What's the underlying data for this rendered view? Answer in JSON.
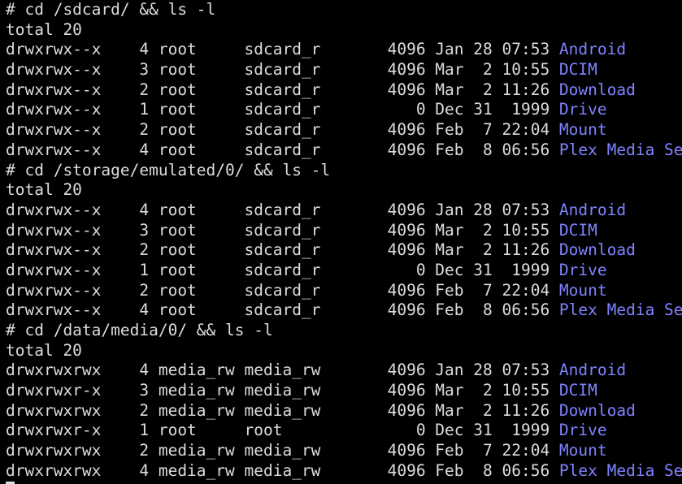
{
  "colors": {
    "background": "#000000",
    "text": "#dcdcdc",
    "directory": "#7f83ff"
  },
  "blocks": [
    {
      "command": "# cd /sdcard/ && ls -l",
      "total": "total 20",
      "rows": [
        {
          "meta": "drwxrwx--x    4 root     sdcard_r       4096 Jan 28 07:53 ",
          "name": "Android"
        },
        {
          "meta": "drwxrwx--x    3 root     sdcard_r       4096 Mar  2 10:55 ",
          "name": "DCIM"
        },
        {
          "meta": "drwxrwx--x    2 root     sdcard_r       4096 Mar  2 11:26 ",
          "name": "Download"
        },
        {
          "meta": "drwxrwx--x    1 root     sdcard_r          0 Dec 31  1999 ",
          "name": "Drive"
        },
        {
          "meta": "drwxrwx--x    2 root     sdcard_r       4096 Feb  7 22:04 ",
          "name": "Mount"
        },
        {
          "meta": "drwxrwx--x    4 root     sdcard_r       4096 Feb  8 06:56 ",
          "name": "Plex Media Server"
        }
      ]
    },
    {
      "command": "# cd /storage/emulated/0/ && ls -l",
      "total": "total 20",
      "rows": [
        {
          "meta": "drwxrwx--x    4 root     sdcard_r       4096 Jan 28 07:53 ",
          "name": "Android"
        },
        {
          "meta": "drwxrwx--x    3 root     sdcard_r       4096 Mar  2 10:55 ",
          "name": "DCIM"
        },
        {
          "meta": "drwxrwx--x    2 root     sdcard_r       4096 Mar  2 11:26 ",
          "name": "Download"
        },
        {
          "meta": "drwxrwx--x    1 root     sdcard_r          0 Dec 31  1999 ",
          "name": "Drive"
        },
        {
          "meta": "drwxrwx--x    2 root     sdcard_r       4096 Feb  7 22:04 ",
          "name": "Mount"
        },
        {
          "meta": "drwxrwx--x    4 root     sdcard_r       4096 Feb  8 06:56 ",
          "name": "Plex Media Server"
        }
      ]
    },
    {
      "command": "# cd /data/media/0/ && ls -l",
      "total": "total 20",
      "rows": [
        {
          "meta": "drwxrwxrwx    4 media_rw media_rw       4096 Jan 28 07:53 ",
          "name": "Android"
        },
        {
          "meta": "drwxrwxr-x    3 media_rw media_rw       4096 Mar  2 10:55 ",
          "name": "DCIM"
        },
        {
          "meta": "drwxrwxrwx    2 media_rw media_rw       4096 Mar  2 11:26 ",
          "name": "Download"
        },
        {
          "meta": "drwxrwxr-x    1 root     root              0 Dec 31  1999 ",
          "name": "Drive"
        },
        {
          "meta": "drwxrwxrwx    2 media_rw media_rw       4096 Feb  7 22:04 ",
          "name": "Mount"
        },
        {
          "meta": "drwxrwxrwx    4 media_rw media_rw       4096 Feb  8 06:56 ",
          "name": "Plex Media Server"
        }
      ]
    }
  ]
}
